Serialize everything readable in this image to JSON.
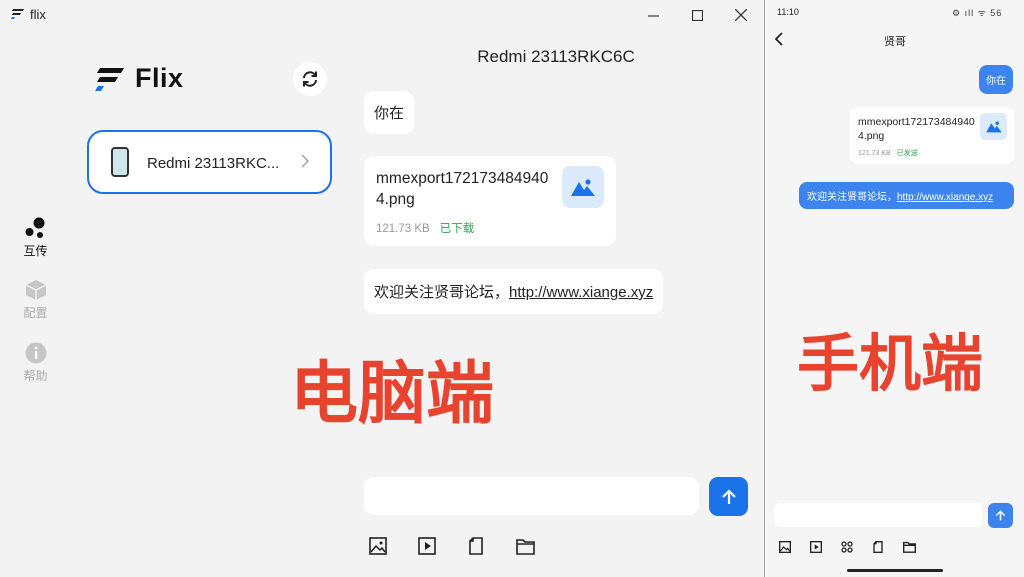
{
  "desktop": {
    "window_title": "flix",
    "brand": "Flix",
    "nav": [
      {
        "label": "互传",
        "icon": "share-dots-icon"
      },
      {
        "label": "配置",
        "icon": "cube-icon"
      },
      {
        "label": "帮助",
        "icon": "info-icon"
      }
    ],
    "device": {
      "name": "Redmi 23113RKC..."
    },
    "chat": {
      "title": "Redmi 23113RKC6C",
      "messages": [
        {
          "type": "text",
          "text": "你在"
        },
        {
          "type": "file",
          "name": "mmexport1721734849404.png",
          "size": "121.73 KB",
          "status": "已下载"
        },
        {
          "type": "text_link",
          "prefix": "欢迎关注贤哥论坛，",
          "link": "http://www.xiange.xyz"
        }
      ]
    },
    "overlay_label": "电脑端"
  },
  "phone": {
    "time": "11:10",
    "status_icons": "⚙ ıll ᯤ 56",
    "title": "贤哥",
    "messages": [
      {
        "type": "text",
        "text": "你在"
      },
      {
        "type": "file",
        "name": "mmexport1721734849404.png",
        "size": "121.73 KB",
        "status": "已发送"
      },
      {
        "type": "text_link",
        "prefix": "欢迎关注贤哥论坛，",
        "link": "http://www.xiange.xyz"
      }
    ],
    "overlay_label": "手机端"
  },
  "colors": {
    "accent": "#1a73e8",
    "overlay": "#e8432e",
    "success": "#29a847"
  }
}
